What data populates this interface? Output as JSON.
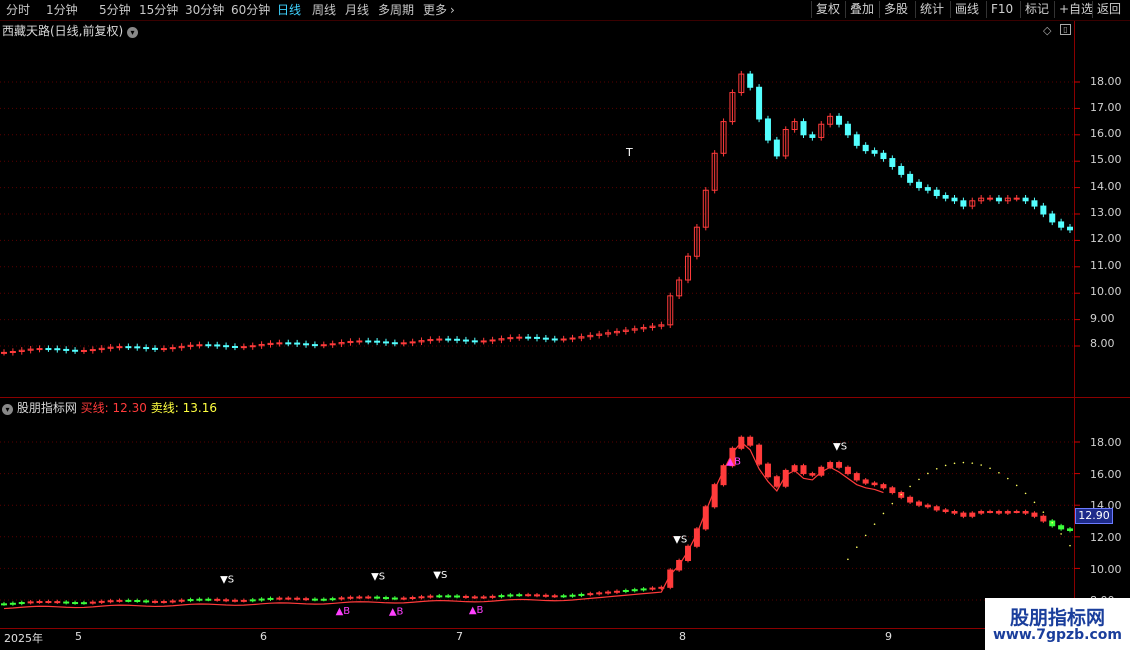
{
  "toolbar": {
    "periods": [
      "分时",
      "1分钟",
      "5分钟",
      "15分钟",
      "30分钟",
      "60分钟",
      "日线",
      "周线",
      "月线",
      "多周期",
      "更多"
    ],
    "active_period": "日线",
    "more_arrow": "›",
    "right_buttons": [
      "复权",
      "叠加",
      "多股",
      "统计",
      "画线",
      "F10",
      "标记",
      "+自选",
      "返回"
    ]
  },
  "main_panel": {
    "title": "西藏天路(日线,前复权)",
    "y_ticks": [
      "18.00",
      "17.00",
      "16.00",
      "15.00",
      "14.00",
      "13.00",
      "12.00",
      "11.00",
      "10.00",
      "9.00",
      "8.00"
    ],
    "annotation": "T"
  },
  "indicator_panel": {
    "title": "股朋指标网",
    "buy_label": "买线:",
    "buy_value": "12.30",
    "sell_label": "卖线:",
    "sell_value": "13.16",
    "y_ticks": [
      "18.00",
      "16.00",
      "14.00",
      "12.00",
      "10.00",
      "8.00"
    ],
    "current_price": "12.90",
    "sell_signal": "S",
    "buy_signal": "B"
  },
  "date_axis": {
    "labels": [
      "2025年",
      "5",
      "6",
      "7",
      "8",
      "9"
    ]
  },
  "watermark": {
    "line1": "股朋指标网",
    "line2": "www.7gpzb.com"
  },
  "colors": {
    "up": "#ff3b3b",
    "down": "#54ffff",
    "green": "#3cff3c",
    "active": "#3fd3ff",
    "grid": "#5a0000",
    "buy_line": "#ff3b3b",
    "sell_marker": "#ffffff",
    "buy_marker": "#ff40ff"
  },
  "icons": {
    "panel_menu": "chevron-down-icon",
    "diamond": "diamond-icon",
    "panel_toggle": "panel-toggle-icon"
  }
}
